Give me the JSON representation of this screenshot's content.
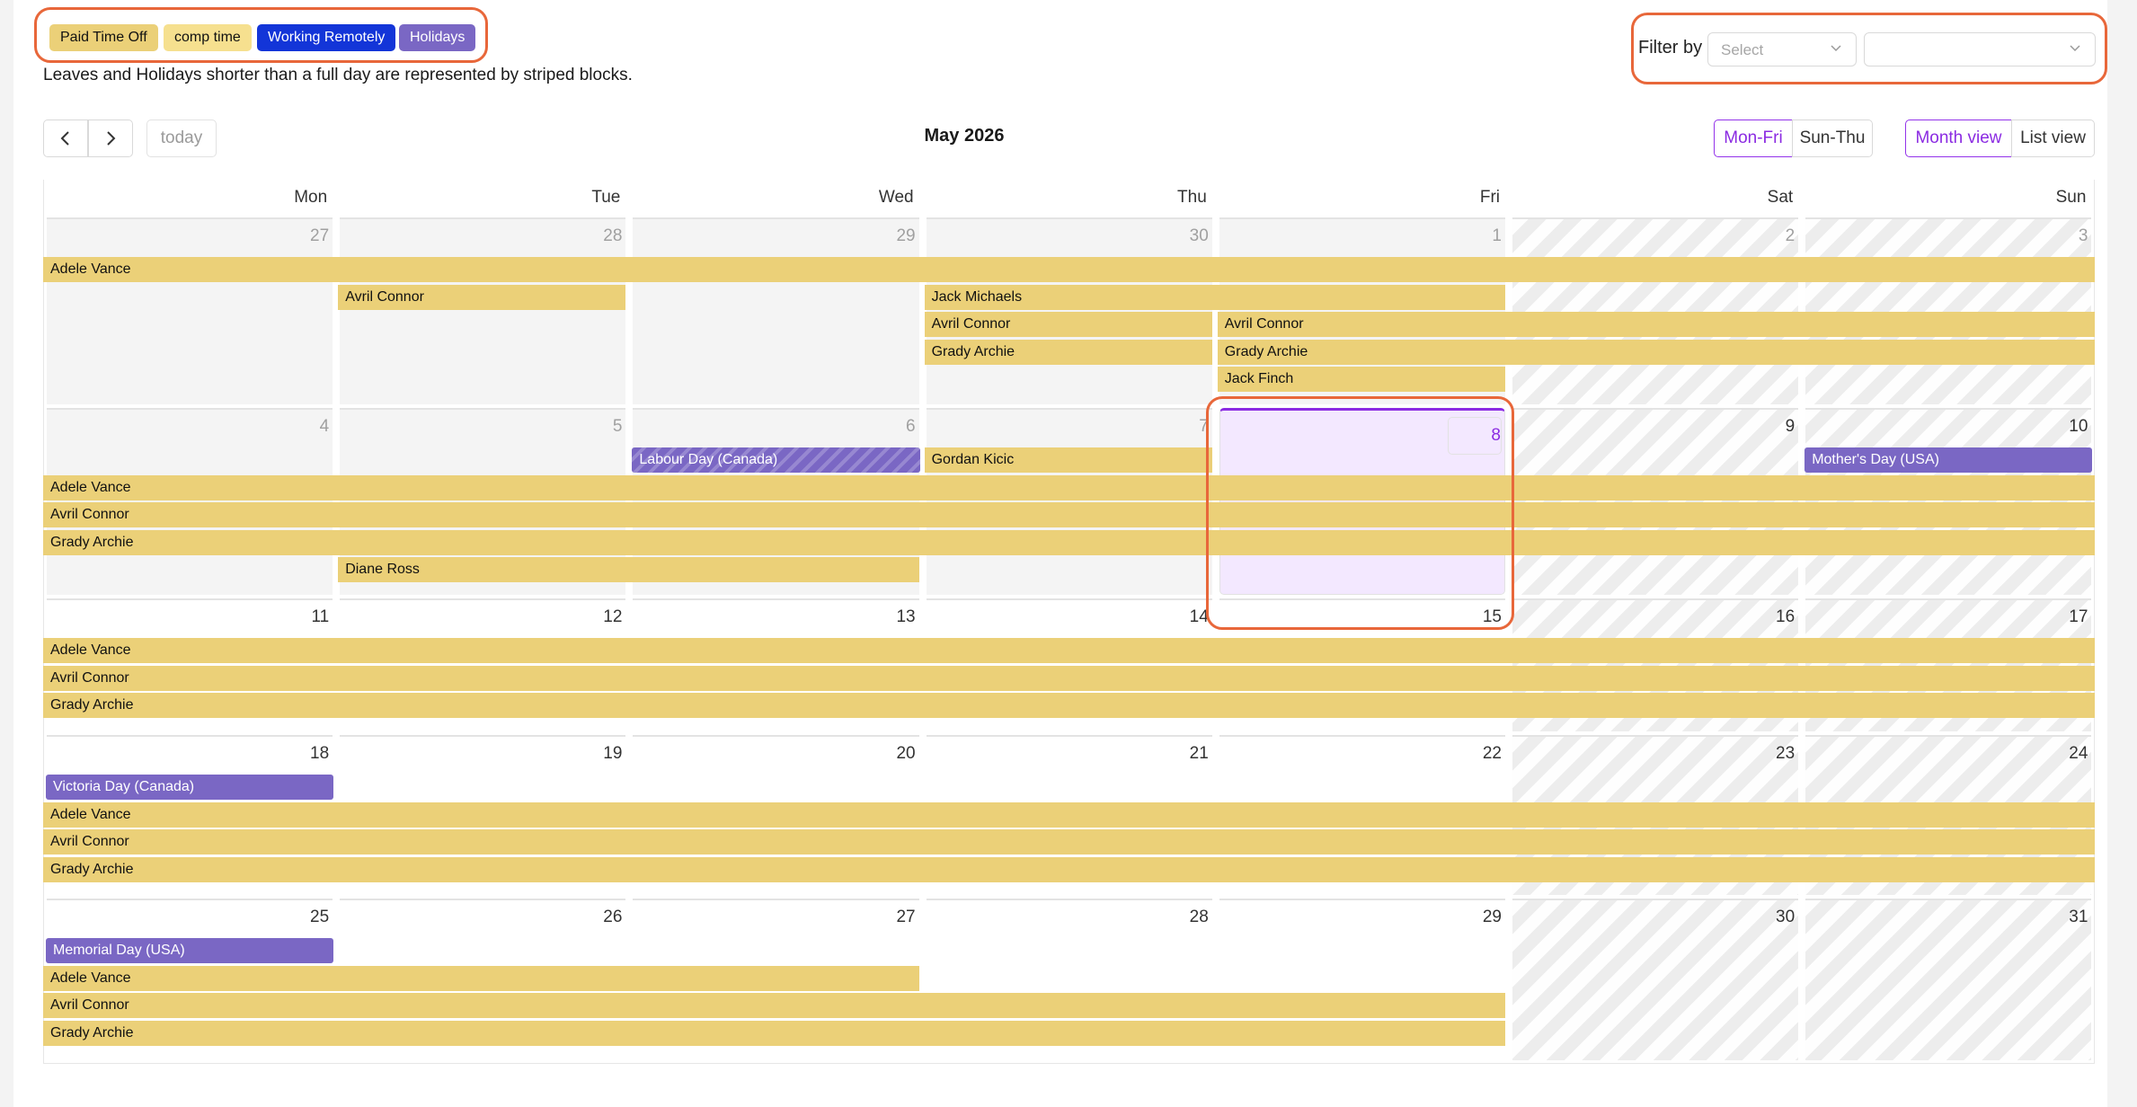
{
  "legend": [
    {
      "label": "Paid Time Off",
      "color": "#ebd078"
    },
    {
      "label": "comp time",
      "color": "#f6e08f"
    },
    {
      "label": "Working Remotely",
      "color": "#1335d8"
    },
    {
      "label": "Holidays",
      "color": "#7a67c4"
    }
  ],
  "legend_note": "Leaves and Holidays shorter than a full day are represented by striped blocks.",
  "filter": {
    "label": "Filter by",
    "select1_placeholder": "Select",
    "select2_placeholder": ""
  },
  "toolbar": {
    "prev_icon": "chevron-left-icon",
    "next_icon": "chevron-right-icon",
    "today_label": "today",
    "title": "May 2026",
    "workweek_options": [
      "Mon-Fri",
      "Sun-Thu"
    ],
    "workweek_selected": "Mon-Fri",
    "view_options": [
      "Month view",
      "List view"
    ],
    "view_selected": "Month view"
  },
  "calendar": {
    "days_of_week": [
      "Mon",
      "Tue",
      "Wed",
      "Thu",
      "Fri",
      "Sat",
      "Sun"
    ],
    "weeks": [
      {
        "days": [
          {
            "num": "27",
            "state": "past"
          },
          {
            "num": "28",
            "state": "past"
          },
          {
            "num": "29",
            "state": "past"
          },
          {
            "num": "30",
            "state": "past"
          },
          {
            "num": "1",
            "state": "past"
          },
          {
            "num": "2",
            "state": "weekend-past"
          },
          {
            "num": "3",
            "state": "weekend-past"
          }
        ],
        "events": [
          {
            "label": "Adele Vance",
            "type": "pto",
            "start": 0,
            "span": 7,
            "lane": 0
          },
          {
            "label": "Avril Connor",
            "type": "pto",
            "start": 1,
            "span": 1,
            "lane": 1
          },
          {
            "label": "Jack Michaels",
            "type": "pto",
            "start": 3,
            "span": 2,
            "lane": 1
          },
          {
            "label": "Avril Connor",
            "type": "pto",
            "start": 3,
            "span": 1,
            "lane": 2
          },
          {
            "label": "Avril Connor",
            "type": "pto",
            "start": 4,
            "span": 3,
            "lane": 2
          },
          {
            "label": "Grady Archie",
            "type": "pto",
            "start": 3,
            "span": 1,
            "lane": 3
          },
          {
            "label": "Grady Archie",
            "type": "pto",
            "start": 4,
            "span": 3,
            "lane": 3
          },
          {
            "label": "Jack Finch",
            "type": "pto",
            "start": 4,
            "span": 1,
            "lane": 4
          }
        ]
      },
      {
        "days": [
          {
            "num": "4",
            "state": "past"
          },
          {
            "num": "5",
            "state": "past"
          },
          {
            "num": "6",
            "state": "past"
          },
          {
            "num": "7",
            "state": "past"
          },
          {
            "num": "8",
            "state": "today"
          },
          {
            "num": "9",
            "state": "weekend"
          },
          {
            "num": "10",
            "state": "weekend"
          }
        ],
        "events": [
          {
            "label": "Labour Day (Canada)",
            "type": "holiday-partial",
            "start": 2,
            "span": 1,
            "lane": 0
          },
          {
            "label": "Gordan Kicic",
            "type": "pto",
            "start": 3,
            "span": 1,
            "lane": 0
          },
          {
            "label": "Mother's Day (USA)",
            "type": "holiday",
            "start": 6,
            "span": 1,
            "lane": 0
          },
          {
            "label": "Adele Vance",
            "type": "pto",
            "start": 0,
            "span": 7,
            "lane": 1
          },
          {
            "label": "Avril Connor",
            "type": "pto",
            "start": 0,
            "span": 7,
            "lane": 2
          },
          {
            "label": "Grady Archie",
            "type": "pto",
            "start": 0,
            "span": 7,
            "lane": 3
          },
          {
            "label": "Diane Ross",
            "type": "pto",
            "start": 1,
            "span": 2,
            "lane": 4
          }
        ]
      },
      {
        "days": [
          {
            "num": "11",
            "state": "normal"
          },
          {
            "num": "12",
            "state": "normal"
          },
          {
            "num": "13",
            "state": "normal"
          },
          {
            "num": "14",
            "state": "normal"
          },
          {
            "num": "15",
            "state": "normal"
          },
          {
            "num": "16",
            "state": "weekend"
          },
          {
            "num": "17",
            "state": "weekend"
          }
        ],
        "events": [
          {
            "label": "Adele Vance",
            "type": "pto",
            "start": 0,
            "span": 7,
            "lane": 0
          },
          {
            "label": "Avril Connor",
            "type": "pto",
            "start": 0,
            "span": 7,
            "lane": 1
          },
          {
            "label": "Grady Archie",
            "type": "pto",
            "start": 0,
            "span": 7,
            "lane": 2
          }
        ]
      },
      {
        "days": [
          {
            "num": "18",
            "state": "normal"
          },
          {
            "num": "19",
            "state": "normal"
          },
          {
            "num": "20",
            "state": "normal"
          },
          {
            "num": "21",
            "state": "normal"
          },
          {
            "num": "22",
            "state": "normal"
          },
          {
            "num": "23",
            "state": "weekend"
          },
          {
            "num": "24",
            "state": "weekend"
          }
        ],
        "events": [
          {
            "label": "Victoria Day (Canada)",
            "type": "holiday",
            "start": 0,
            "span": 1,
            "lane": 0
          },
          {
            "label": "Adele Vance",
            "type": "pto",
            "start": 0,
            "span": 7,
            "lane": 1
          },
          {
            "label": "Avril Connor",
            "type": "pto",
            "start": 0,
            "span": 7,
            "lane": 2
          },
          {
            "label": "Grady Archie",
            "type": "pto",
            "start": 0,
            "span": 7,
            "lane": 3
          }
        ]
      },
      {
        "days": [
          {
            "num": "25",
            "state": "normal"
          },
          {
            "num": "26",
            "state": "normal"
          },
          {
            "num": "27",
            "state": "normal"
          },
          {
            "num": "28",
            "state": "normal"
          },
          {
            "num": "29",
            "state": "normal"
          },
          {
            "num": "30",
            "state": "weekend"
          },
          {
            "num": "31",
            "state": "weekend"
          }
        ],
        "events": [
          {
            "label": "Memorial Day (USA)",
            "type": "holiday",
            "start": 0,
            "span": 1,
            "lane": 0
          },
          {
            "label": "Adele Vance",
            "type": "pto",
            "start": 0,
            "span": 3,
            "lane": 1
          },
          {
            "label": "Avril Connor",
            "type": "pto",
            "start": 0,
            "span": 5,
            "lane": 2
          },
          {
            "label": "Grady Archie",
            "type": "pto",
            "start": 0,
            "span": 5,
            "lane": 3
          }
        ]
      }
    ]
  }
}
